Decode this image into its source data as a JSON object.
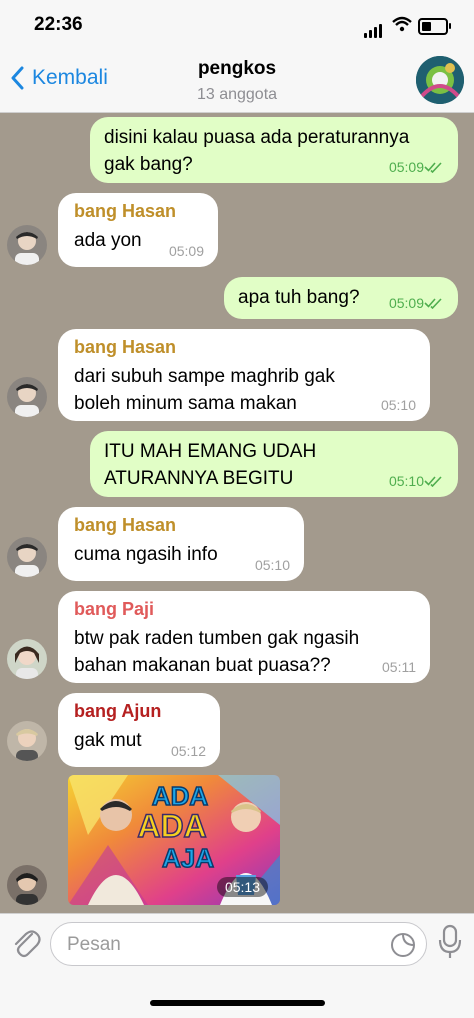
{
  "status_bar": {
    "time": "22:36"
  },
  "header": {
    "back_label": "Kembali",
    "title": "pengkos",
    "subtitle": "13 anggota"
  },
  "messages": [
    {
      "type": "out",
      "text": "disini kalau puasa ada peraturannya\ngak bang?",
      "time": "05:09"
    },
    {
      "type": "in",
      "sender": "bang Hasan",
      "sender_color": "#bf8f2a",
      "text": "ada yon",
      "time": "05:09"
    },
    {
      "type": "out",
      "text": "apa tuh bang?",
      "time": "05:09"
    },
    {
      "type": "in",
      "sender": "bang Hasan",
      "sender_color": "#bf8f2a",
      "text": "dari subuh sampe maghrib gak\nboleh minum sama makan",
      "time": "05:10"
    },
    {
      "type": "out",
      "text": "ITU MAH EMANG UDAH\nATURANNYA BEGITU",
      "time": "05:10"
    },
    {
      "type": "in",
      "sender": "bang Hasan",
      "sender_color": "#bf8f2a",
      "text": "cuma ngasih info",
      "time": "05:10"
    },
    {
      "type": "in",
      "sender": "bang Paji",
      "sender_color": "#e05a5a",
      "text": "btw pak raden tumben gak ngasih\nbahan makanan buat puasa??",
      "time": "05:11"
    },
    {
      "type": "in",
      "sender": "bang Ajun",
      "sender_color": "#b52020",
      "text": "gak mut",
      "time": "05:12"
    }
  ],
  "media_message": {
    "time": "05:13",
    "logo_words": [
      "ADA",
      "ADA",
      "AJA"
    ]
  },
  "composer": {
    "placeholder": "Pesan"
  },
  "colors": {
    "accent": "#1c87e0",
    "chat_background": "#a39a8d",
    "outgoing_bubble": "#e1fec6",
    "incoming_bubble": "#ffffff",
    "tick_green": "#4fae4e"
  }
}
